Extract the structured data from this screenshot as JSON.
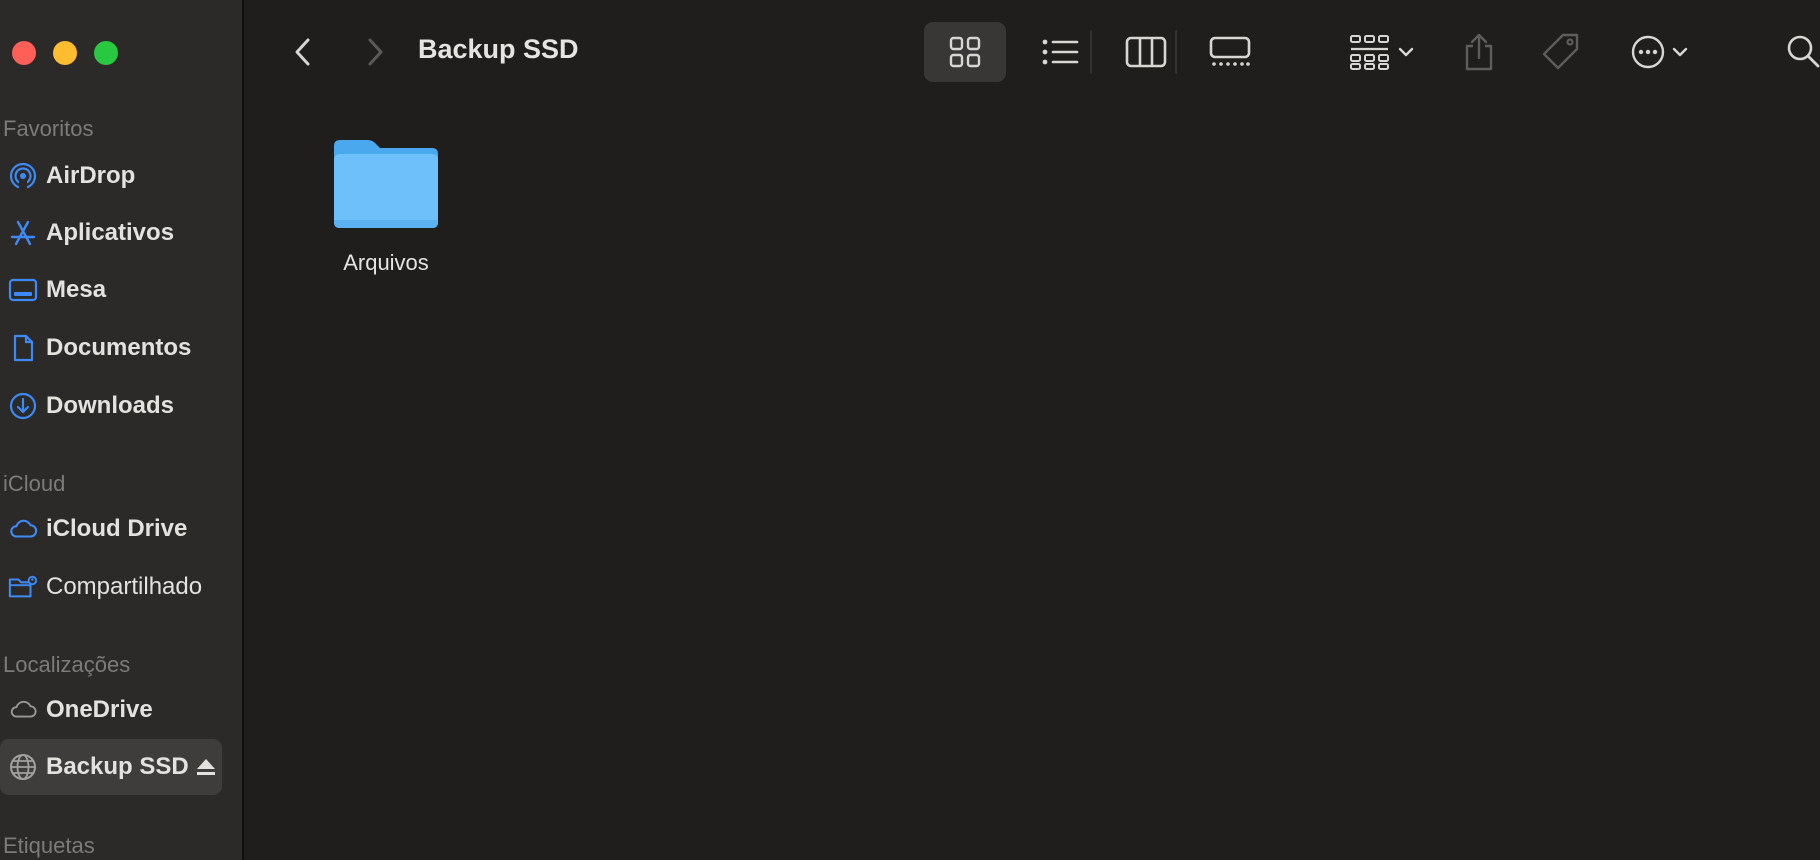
{
  "window": {
    "title": "Backup SSD"
  },
  "sidebar": {
    "sections": {
      "favoritos": "Favoritos",
      "icloud": "iCloud",
      "localizacoes": "Localizações",
      "etiquetas": "Etiquetas"
    },
    "favoritos": [
      {
        "label": "AirDrop",
        "icon": "airdrop-icon"
      },
      {
        "label": "Aplicativos",
        "icon": "applications-icon"
      },
      {
        "label": "Mesa",
        "icon": "desktop-icon"
      },
      {
        "label": "Documentos",
        "icon": "document-icon"
      },
      {
        "label": "Downloads",
        "icon": "download-icon"
      }
    ],
    "icloud": [
      {
        "label": "iCloud Drive",
        "icon": "cloud-icon"
      },
      {
        "label": "Compartilhado",
        "icon": "shared-folder-icon"
      }
    ],
    "localizacoes": [
      {
        "label": "OneDrive",
        "icon": "cloud-outline-icon"
      },
      {
        "label": "Backup SSD",
        "icon": "globe-icon",
        "selected": true
      }
    ]
  },
  "toolbar": {
    "view_mode_active": "icon"
  },
  "content": {
    "items": [
      {
        "name": "Arquivos",
        "type": "folder"
      }
    ]
  },
  "colors": {
    "accent": "#3d8af7",
    "folder": "#6ec0fa",
    "background": "#1f1e1d",
    "sidebar": "#2b2a29"
  }
}
